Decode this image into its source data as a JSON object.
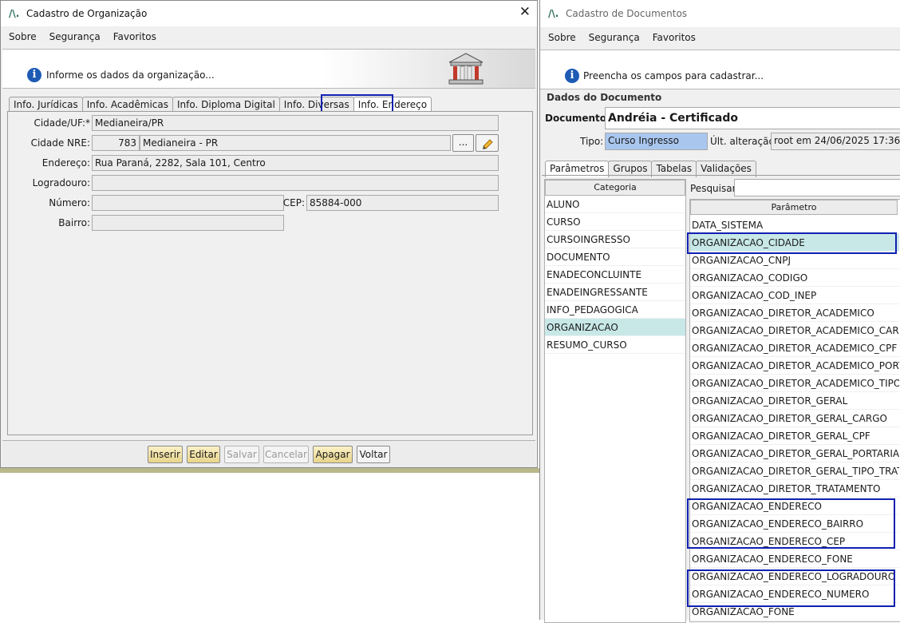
{
  "left_window": {
    "title": "Cadastro de Organização",
    "close_glyph": "✕",
    "menu": [
      "Sobre",
      "Segurança",
      "Favoritos"
    ],
    "banner_text": "Informe os dados da organização...",
    "tabs": [
      "Info. Jurídicas",
      "Info. Acadêmicas",
      "Info. Diploma Digital",
      "Info. Diversas",
      "Info. Endereço"
    ],
    "form": {
      "cidade_uf_label": "Cidade/UF:*",
      "cidade_uf_value": "Medianeira/PR",
      "cidade_nre_label": "Cidade NRE:",
      "cidade_nre_code": "783",
      "cidade_nre_name": "Medianeira - PR",
      "browse_label": "...",
      "endereco_label": "Endereço:",
      "endereco_value": "Rua Paraná, 2282, Sala 101, Centro",
      "logradouro_label": "Logradouro:",
      "logradouro_value": "",
      "numero_label": "Número:",
      "numero_value": "",
      "cep_label": "CEP:",
      "cep_value": "85884-000",
      "bairro_label": "Bairro:",
      "bairro_value": ""
    },
    "buttons": {
      "inserir": "Inserir",
      "editar": "Editar",
      "salvar": "Salvar",
      "cancelar": "Cancelar",
      "apagar": "Apagar",
      "voltar": "Voltar"
    }
  },
  "right_window": {
    "title": "Cadastro de Documentos",
    "menu": [
      "Sobre",
      "Segurança",
      "Favoritos"
    ],
    "banner_text": "Preencha os campos para cadastrar...",
    "group_title": "Dados do Documento",
    "documento_label": "Documento:",
    "documento_value": "Andréia - Certificado",
    "tipo_label": "Tipo:",
    "tipo_value": "Curso Ingresso",
    "ult_alteracao_label": "Últ. alteração:",
    "ult_alteracao_value": "root em 24/06/2025 17:36",
    "tabs": [
      "Parâmetros",
      "Grupos",
      "Tabelas",
      "Validações"
    ],
    "categoria_header": "Categoria",
    "categorias": [
      "ALUNO",
      "CURSO",
      "CURSOINGRESSO",
      "DOCUMENTO",
      "ENADECONCLUINTE",
      "ENADEINGRESSANTE",
      "INFO_PEDAGOGICA",
      "ORGANIZACAO",
      "RESUMO_CURSO"
    ],
    "selected_categoria": "ORGANIZACAO",
    "pesquisar_label": "Pesquisar:",
    "pesquisar_value": "",
    "parametro_header": "Parâmetro",
    "parametros": [
      "DATA_SISTEMA",
      "ORGANIZACAO_CIDADE",
      "ORGANIZACAO_CNPJ",
      "ORGANIZACAO_CODIGO",
      "ORGANIZACAO_COD_INEP",
      "ORGANIZACAO_DIRETOR_ACADEMICO",
      "ORGANIZACAO_DIRETOR_ACADEMICO_CARGO",
      "ORGANIZACAO_DIRETOR_ACADEMICO_CPF",
      "ORGANIZACAO_DIRETOR_ACADEMICO_PORT...",
      "ORGANIZACAO_DIRETOR_ACADEMICO_TIPO_...",
      "ORGANIZACAO_DIRETOR_GERAL",
      "ORGANIZACAO_DIRETOR_GERAL_CARGO",
      "ORGANIZACAO_DIRETOR_GERAL_CPF",
      "ORGANIZACAO_DIRETOR_GERAL_PORTARIA",
      "ORGANIZACAO_DIRETOR_GERAL_TIPO_TRATA...",
      "ORGANIZACAO_DIRETOR_TRATAMENTO",
      "ORGANIZACAO_ENDERECO",
      "ORGANIZACAO_ENDERECO_BAIRRO",
      "ORGANIZACAO_ENDERECO_CEP",
      "ORGANIZACAO_ENDERECO_FONE",
      "ORGANIZACAO_ENDERECO_LOGRADOURO",
      "ORGANIZACAO_ENDERECO_NUMERO",
      "ORGANIZACAO_FONE"
    ],
    "selected_parametro": "ORGANIZACAO_CIDADE"
  },
  "colors": {
    "highlight_box": "#1020b0",
    "selection": "#c8e8e8",
    "tipo_bg": "#a9c6ef",
    "info_icon": "#1e5bb5"
  }
}
